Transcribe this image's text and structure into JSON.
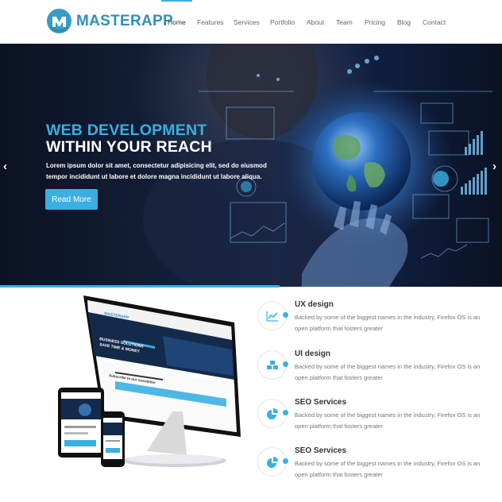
{
  "brand": {
    "name": "MASTERAPP",
    "accent": "#3ab0e2",
    "logo_color": "#2f8fc0"
  },
  "nav": {
    "items": [
      {
        "label": "Home",
        "active": true
      },
      {
        "label": "Features",
        "active": false
      },
      {
        "label": "Services",
        "active": false
      },
      {
        "label": "Portfolio",
        "active": false
      },
      {
        "label": "About",
        "active": false
      },
      {
        "label": "Team",
        "active": false
      },
      {
        "label": "Pricing",
        "active": false
      },
      {
        "label": "Blog",
        "active": false
      },
      {
        "label": "Contact",
        "active": false
      }
    ]
  },
  "hero": {
    "title_line1": "WEB DEVELOPMENT",
    "title_line2": "WITHIN YOUR REACH",
    "text": "Lorem ipsum dolor sit amet, consectetur adipisicing elit, sed do eiusmod tempor incididunt ut labore et dolore magna incididunt ut labore aliqua.",
    "button_label": "Read More",
    "prev_icon": "chevron-left-icon",
    "next_icon": "chevron-right-icon"
  },
  "features": [
    {
      "title": "UX design",
      "icon": "line-chart-icon",
      "desc": "Backed by some of the biggest names in the industry, Firefox OS is an open platform that fosters greater"
    },
    {
      "title": "UI design",
      "icon": "cubes-icon",
      "desc": "Backed by some of the biggest names in the industry, Firefox OS is an open platform that fosters greater"
    },
    {
      "title": "SEO Services",
      "icon": "pie-chart-icon",
      "desc": "Backed by some of the biggest names in the industry, Firefox OS is an open platform that fosters greater"
    },
    {
      "title": "SEO Services",
      "icon": "pie-chart-icon",
      "desc": "Backed by some of the biggest names in the industry, Firefox OS is an open platform that fosters greater"
    }
  ],
  "devices": {
    "brand": "MASTERAPP",
    "screen_heading": "BUSINESS SOLUTIONS",
    "screen_sub": "SAVE TIME & MONEY",
    "newsletter": "Subscribe to our newsletter"
  }
}
